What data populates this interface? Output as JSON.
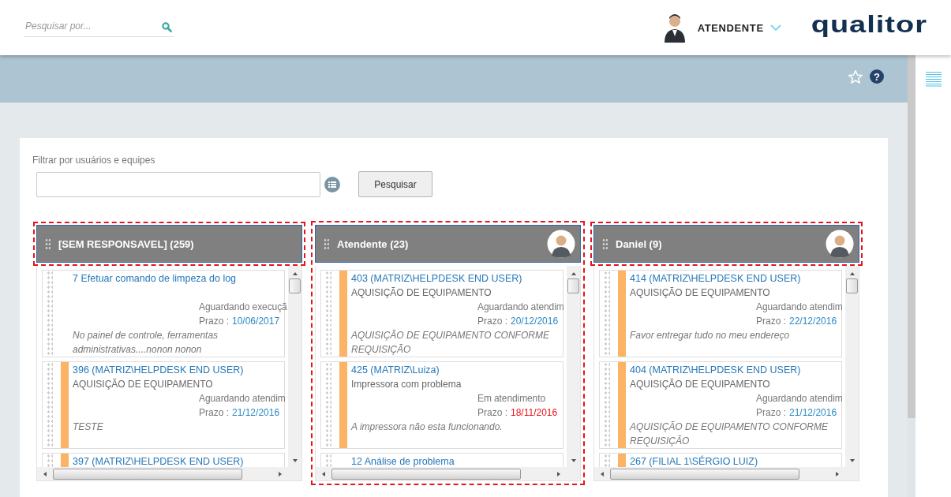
{
  "header": {
    "search": {
      "placeholder": "Pesquisar por..."
    },
    "user": {
      "name": "ATENDENTE"
    },
    "logo": "qualitor"
  },
  "toolbar": {
    "help_glyph": "?"
  },
  "filter": {
    "label": "Filtrar por usuários e equipes",
    "button": "Pesquisar"
  },
  "columns": [
    {
      "title": "[SEM RESPONSAVEL] (259)",
      "avatar": false,
      "header_highlighted": true,
      "column_highlighted": false,
      "cards": [
        {
          "flagged": false,
          "title": "7 Efetuar comando de limpeza do log",
          "status": "Aguardando execuçã",
          "prazo_label": "Prazo :",
          "prazo": "10/06/2017",
          "overdue": false,
          "description": "No painel de controle, ferramentas administrativas....nonon nonon"
        },
        {
          "flagged": true,
          "title": "396 (MATRIZ\\HELPDESK END USER)",
          "subtitle": "AQUISIÇÃO DE EQUIPAMENTO",
          "status": "Aguardando atendim",
          "prazo_label": "Prazo :",
          "prazo": "21/12/2016",
          "overdue": false,
          "description": "TESTE"
        },
        {
          "flagged": true,
          "title": "397 (MATRIZ\\HELPDESK END USER)"
        }
      ]
    },
    {
      "title": "Atendente (23)",
      "avatar": true,
      "header_highlighted": false,
      "column_highlighted": true,
      "cards": [
        {
          "flagged": true,
          "title": "403 (MATRIZ\\HELPDESK END USER)",
          "subtitle": "AQUISIÇÃO DE EQUIPAMENTO",
          "status": "Aguardando atendim",
          "prazo_label": "Prazo :",
          "prazo": "20/12/2016",
          "overdue": false,
          "description": "AQUISIÇÃO DE EQUIPAMENTO CONFORME REQUISIÇÃO"
        },
        {
          "flagged": true,
          "title": "425 (MATRIZ\\Luiza)",
          "subtitle": "Impressora com problema",
          "status": "Em atendimento",
          "prazo_label": "Prazo :",
          "prazo": "18/11/2016",
          "overdue": true,
          "description": "A impressora não esta funcionando."
        },
        {
          "flagged": false,
          "title": "12 Análise de problema"
        }
      ]
    },
    {
      "title": "Daniel (9)",
      "avatar": true,
      "header_highlighted": true,
      "column_highlighted": false,
      "cards": [
        {
          "flagged": true,
          "title": "414 (MATRIZ\\HELPDESK END USER)",
          "subtitle": "AQUISIÇÃO DE EQUIPAMENTO",
          "status": "Aguardando atendim",
          "prazo_label": "Prazo :",
          "prazo": "22/12/2016",
          "overdue": false,
          "description": "Favor entregar tudo no meu endereço"
        },
        {
          "flagged": true,
          "title": "404 (MATRIZ\\HELPDESK END USER)",
          "subtitle": "AQUISIÇÃO DE EQUIPAMENTO",
          "status": "Aguardando atendim",
          "prazo_label": "Prazo :",
          "prazo": "21/12/2016",
          "overdue": false,
          "description": "AQUISIÇÃO DE EQUIPAMENTO CONFORME REQUISIÇÃO"
        },
        {
          "flagged": true,
          "title": "267 (FILIAL 1\\SÉRGIO LUIZ)"
        }
      ]
    }
  ]
}
